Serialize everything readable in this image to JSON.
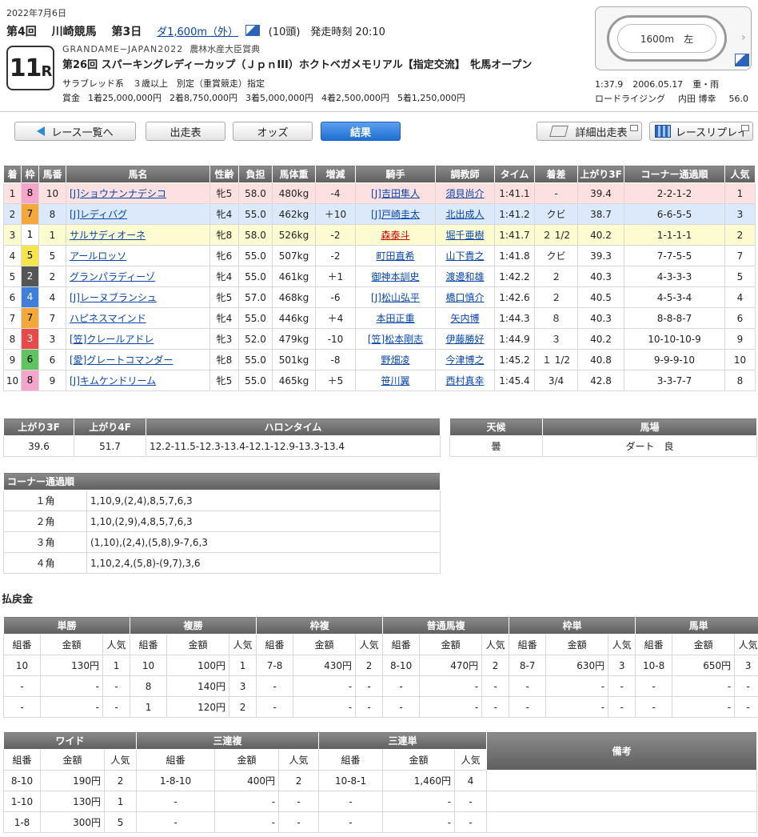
{
  "header": {
    "date": "2022年7月6日",
    "kai": "第4回",
    "venue": "川崎競馬",
    "day": "第3日",
    "course": "ダ1,600m（外）",
    "heads": "(10頭)",
    "post_time": "発走時刻 20:10",
    "race_num": "11",
    "race_suffix": "R",
    "series": "GRANDAME−JAPAN2022",
    "prize_name": "農林水産大臣賞典",
    "race_name": "第26回 スパーキングレディーカップ（ＪｐｎIII）ホクトベガメモリアル【指定交流】　牝馬オープン",
    "conditions": "サラブレッド系　３歳以上　別定（重賞競走）指定",
    "prizes": [
      "賞金",
      "1着25,000,000円",
      "2着8,750,000円",
      "3着5,000,000円",
      "4着2,500,000円",
      "5着1,250,000円"
    ],
    "track_distance": "1600m　左",
    "track_arrow": "›",
    "record": [
      "1:37.9",
      "2006.05.17",
      "重・雨"
    ],
    "record2": [
      "ロードライジング",
      "内田 博幸",
      "56.0"
    ]
  },
  "nav": {
    "back": "レース一覧へ",
    "entries": "出走表",
    "odds": "オッズ",
    "result": "結果",
    "detail": "詳細出走表",
    "replay": "レースリプレイ"
  },
  "results": {
    "headers": [
      "着",
      "枠",
      "馬番",
      "馬名",
      "性齢",
      "負担",
      "馬体重",
      "増減",
      "騎手",
      "調教師",
      "タイム",
      "着差",
      "上がり3F",
      "コーナー通過順",
      "人気"
    ],
    "rows": [
      {
        "pos": "1",
        "waku": "8",
        "num": "10",
        "horse": "[J]ショウナンナデシコ",
        "sex": "牝5",
        "wt": "58.0",
        "bw": "480kg",
        "diff": "-4",
        "jockey": "[J]吉田隼人",
        "trainer": "須貝尚介",
        "time": "1:41.1",
        "margin": "-",
        "f3": "39.4",
        "corner": "2-2-1-2",
        "pop": "1"
      },
      {
        "pos": "2",
        "waku": "7",
        "num": "8",
        "horse": "[J]レディバグ",
        "sex": "牝4",
        "wt": "55.0",
        "bw": "462kg",
        "diff": "＋10",
        "jockey": "[J]戸崎圭太",
        "trainer": "北出成人",
        "time": "1:41.2",
        "margin": "クビ",
        "f3": "38.7",
        "corner": "6-6-5-5",
        "pop": "3"
      },
      {
        "pos": "3",
        "waku": "1",
        "num": "1",
        "horse": "サルサディオーネ",
        "sex": "牝8",
        "wt": "58.0",
        "bw": "526kg",
        "diff": "-2",
        "jockey": "森泰斗",
        "trainer": "堀千亜樹",
        "time": "1:41.7",
        "margin": "２ 1/2",
        "f3": "40.2",
        "corner": "1-1-1-1",
        "pop": "2"
      },
      {
        "pos": "4",
        "waku": "5",
        "num": "5",
        "horse": "アールロッソ",
        "sex": "牝6",
        "wt": "55.0",
        "bw": "507kg",
        "diff": "-2",
        "jockey": "町田直希",
        "trainer": "山下貴之",
        "time": "1:41.8",
        "margin": "クビ",
        "f3": "39.3",
        "corner": "7-7-5-5",
        "pop": "7"
      },
      {
        "pos": "5",
        "waku": "2",
        "num": "2",
        "horse": "グランパラディーゾ",
        "sex": "牝4",
        "wt": "55.0",
        "bw": "461kg",
        "diff": "＋1",
        "jockey": "御神本訓史",
        "trainer": "渡邊和雄",
        "time": "1:42.2",
        "margin": "２",
        "f3": "40.3",
        "corner": "4-3-3-3",
        "pop": "5"
      },
      {
        "pos": "6",
        "waku": "4",
        "num": "4",
        "horse": "[J]レーヌブランシュ",
        "sex": "牝5",
        "wt": "57.0",
        "bw": "468kg",
        "diff": "-6",
        "jockey": "[J]松山弘平",
        "trainer": "橋口慎介",
        "time": "1:42.6",
        "margin": "２",
        "f3": "40.5",
        "corner": "4-5-3-4",
        "pop": "4"
      },
      {
        "pos": "7",
        "waku": "7",
        "num": "7",
        "horse": "ハピネスマインド",
        "sex": "牝4",
        "wt": "55.0",
        "bw": "446kg",
        "diff": "＋4",
        "jockey": "本田正重",
        "trainer": "矢内博",
        "time": "1:44.3",
        "margin": "８",
        "f3": "40.3",
        "corner": "8-8-8-7",
        "pop": "6"
      },
      {
        "pos": "8",
        "waku": "3",
        "num": "3",
        "horse": "[笠]クレールアドレ",
        "sex": "牝3",
        "wt": "52.0",
        "bw": "479kg",
        "diff": "-10",
        "jockey": "[笠]松本剛志",
        "trainer": "伊藤勝好",
        "time": "1:44.9",
        "margin": "３",
        "f3": "40.2",
        "corner": "10-10-10-9",
        "pop": "9"
      },
      {
        "pos": "9",
        "waku": "6",
        "num": "6",
        "horse": "[愛]グレートコマンダー",
        "sex": "牝8",
        "wt": "55.0",
        "bw": "501kg",
        "diff": "-8",
        "jockey": "野畑凌",
        "trainer": "今津博之",
        "time": "1:45.2",
        "margin": "１ 1/2",
        "f3": "40.8",
        "corner": "9-9-9-10",
        "pop": "10"
      },
      {
        "pos": "10",
        "waku": "8",
        "num": "9",
        "horse": "[J]キムケンドリーム",
        "sex": "牝5",
        "wt": "55.0",
        "bw": "465kg",
        "diff": "＋5",
        "jockey": "笹川翼",
        "trainer": "西村真幸",
        "time": "1:45.4",
        "margin": "3/4",
        "f3": "42.8",
        "corner": "3-3-7-7",
        "pop": "8"
      }
    ]
  },
  "laps": {
    "headers": [
      "上がり3F",
      "上がり4F",
      "ハロンタイム"
    ],
    "values": [
      "39.6",
      "51.7",
      "12.2-11.5-12.3-13.4-12.1-12.9-13.3-13.4"
    ]
  },
  "weather": {
    "headers": [
      "天候",
      "馬場"
    ],
    "values": [
      "曇",
      "ダート　良"
    ]
  },
  "corner": {
    "title": "コーナー通過順",
    "rows": [
      {
        "label": "１角",
        "value": "1,10,9,(2,4),8,5,7,6,3"
      },
      {
        "label": "２角",
        "value": "1,10,(2,9),4,8,5,7,6,3"
      },
      {
        "label": "３角",
        "value": "(1,10),(2,4),(5,8),9-7,6,3"
      },
      {
        "label": "４角",
        "value": "1,10,2,4,(5,8)-(9,7),3,6"
      }
    ]
  },
  "payout": {
    "title": "払戻金",
    "table1": {
      "groups": [
        "単勝",
        "複勝",
        "枠複",
        "普通馬複",
        "枠単",
        "馬単"
      ],
      "sub": [
        "組番",
        "金額",
        "人気"
      ],
      "rows": [
        [
          "10",
          "130円",
          "1",
          "10",
          "100円",
          "1",
          "7-8",
          "430円",
          "2",
          "8-10",
          "470円",
          "2",
          "8-7",
          "630円",
          "3",
          "10-8",
          "650円",
          "3"
        ],
        [
          "-",
          "-",
          "-",
          "8",
          "140円",
          "3",
          "-",
          "-",
          "-",
          "-",
          "-",
          "-",
          "-",
          "-",
          "-",
          "-",
          "-",
          "-"
        ],
        [
          "-",
          "-",
          "-",
          "1",
          "120円",
          "2",
          "-",
          "-",
          "-",
          "-",
          "-",
          "-",
          "-",
          "-",
          "-",
          "-",
          "-",
          "-"
        ]
      ]
    },
    "table2": {
      "groups": [
        "ワイド",
        "三連複",
        "三連単",
        "備考"
      ],
      "sub": [
        "組番",
        "金額",
        "人気"
      ],
      "rows": [
        [
          "8-10",
          "190円",
          "2",
          "1-8-10",
          "400円",
          "2",
          "10-8-1",
          "1,460円",
          "4"
        ],
        [
          "1-10",
          "130円",
          "1",
          "-",
          "-",
          "-",
          "-",
          "-",
          "-"
        ],
        [
          "1-8",
          "300円",
          "5",
          "-",
          "-",
          "-",
          "-",
          "-",
          "-"
        ]
      ]
    }
  }
}
